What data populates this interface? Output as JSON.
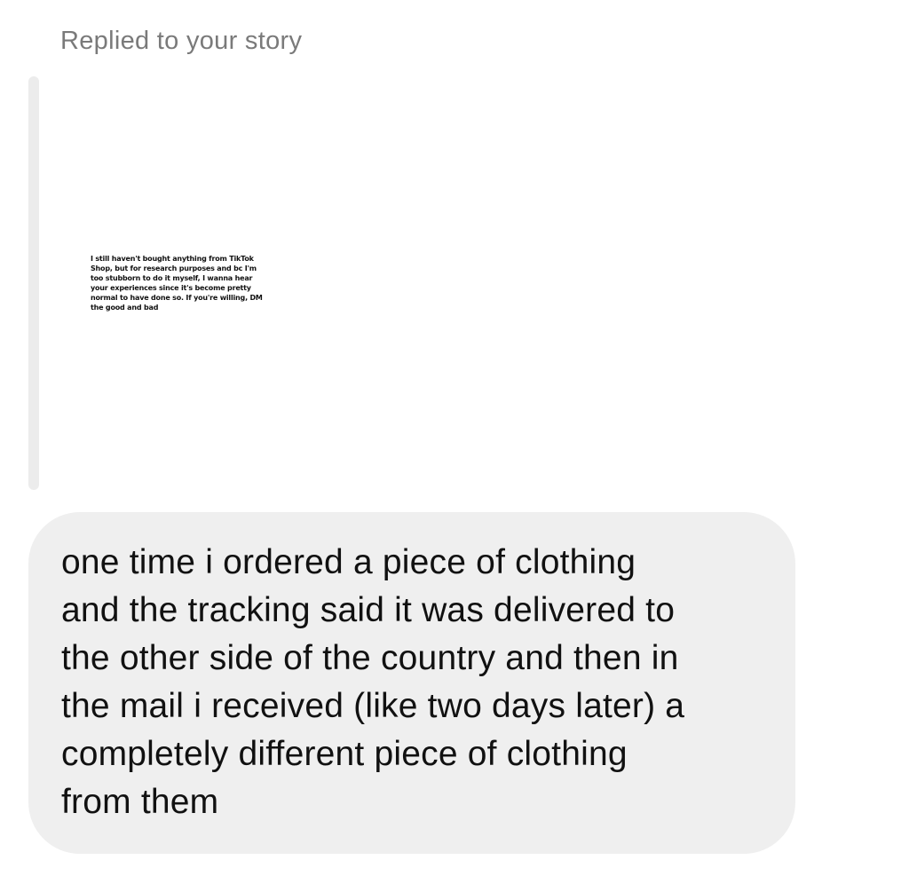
{
  "reply_header": "Replied to your story",
  "story": {
    "text": "I still haven't bought anything from TikTok Shop, but for research purposes and bc I'm too stubborn to do it myself, I wanna hear your experiences since it's become pretty normal to have done so. If you're willing, DM the good and bad"
  },
  "message": {
    "lines": [
      "one time i ordered a piece of clothing",
      "and the tracking said it was delivered to",
      "the other side of the country and then in",
      "the mail i received (like two days later) a",
      "completely different piece of clothing",
      "from them"
    ]
  },
  "colors": {
    "bubble_background": "#efefef",
    "story_bar": "#ececec",
    "header_text": "#7a7a7a",
    "message_text": "#111111"
  }
}
